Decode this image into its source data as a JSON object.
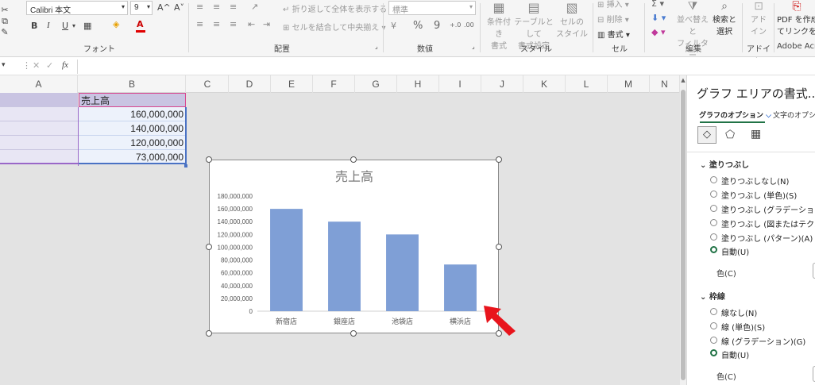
{
  "ribbon": {
    "font_name": "Calibri 本文",
    "font_size": "9",
    "grow": "A^",
    "shrink": "A˅",
    "bold": "B",
    "italic": "I",
    "underline": "U",
    "wrap_text": "折り返して全体を表示する",
    "merge_center": "セルを結合して中央揃え",
    "number_format": "標準",
    "percent": "%",
    "comma": "9",
    "dec_inc": "+.0",
    "dec_dec": ".00",
    "cond_format": [
      "条件付き",
      "書式"
    ],
    "table_format": [
      "テーブルとして",
      "書式設定"
    ],
    "cell_style": [
      "セルの",
      "スタイル"
    ],
    "insert": "挿入",
    "delete": "削除",
    "format": "書式",
    "sort_filter": [
      "並べ替えと",
      "フィルター"
    ],
    "find_select": [
      "検索と",
      "選択"
    ],
    "addin": [
      "アド",
      "イン"
    ],
    "pdf": [
      "PDF を作成",
      "てリンクを共"
    ],
    "groups": {
      "font": "フォント",
      "alignment": "配置",
      "number": "数値",
      "style": "スタイル",
      "cell": "セル",
      "edit": "編集",
      "addin": "アドイン",
      "adobe": "Adobe Acro"
    }
  },
  "formula_bar": {
    "fx": "fx",
    "content": ""
  },
  "columns": [
    "A",
    "B",
    "C",
    "D",
    "E",
    "F",
    "G",
    "H",
    "I",
    "J",
    "K",
    "L",
    "M",
    "N"
  ],
  "table": {
    "header": "売上高",
    "values": [
      "160,000,000",
      "140,000,000",
      "120,000,000",
      "73,000,000"
    ]
  },
  "chart_data": {
    "type": "bar",
    "title": "売上高",
    "categories": [
      "新宿店",
      "銀座店",
      "池袋店",
      "横浜店"
    ],
    "values": [
      160000000,
      140000000,
      120000000,
      73000000
    ],
    "ylim": [
      0,
      180000000
    ],
    "yticks": [
      "180,000,000",
      "160,000,000",
      "140,000,000",
      "120,000,000",
      "100,000,000",
      "80,000,000",
      "60,000,000",
      "40,000,000",
      "20,000,000",
      "0"
    ],
    "xlabel": "",
    "ylabel": "",
    "grid": false,
    "legend": "none",
    "bar_color": "#7f9fd6"
  },
  "pane": {
    "title": "グラフ エリアの書式...",
    "tab_graph": "グラフのオプション",
    "tab_text": "文字のオプショ",
    "fill_section": "塗りつぶし",
    "fill_options": [
      "塗りつぶしなし(N)",
      "塗りつぶし (単色)(S)",
      "塗りつぶし (グラデーション)(G)",
      "塗りつぶし (図またはテクスチャ)(P",
      "塗りつぶし (パターン)(A)",
      "自動(U)"
    ],
    "fill_selected": 5,
    "color_label": "色(C)",
    "line_section": "枠線",
    "line_options": [
      "線なし(N)",
      "線 (単色)(S)",
      "線 (グラデーション)(G)",
      "自動(U)"
    ],
    "line_selected": 3,
    "color_label2": "色(C)"
  },
  "colors": {
    "accent": "#217346",
    "arrow": "#e8141c",
    "bar": "#7f9fd6",
    "selection": "#e8e6f4"
  }
}
